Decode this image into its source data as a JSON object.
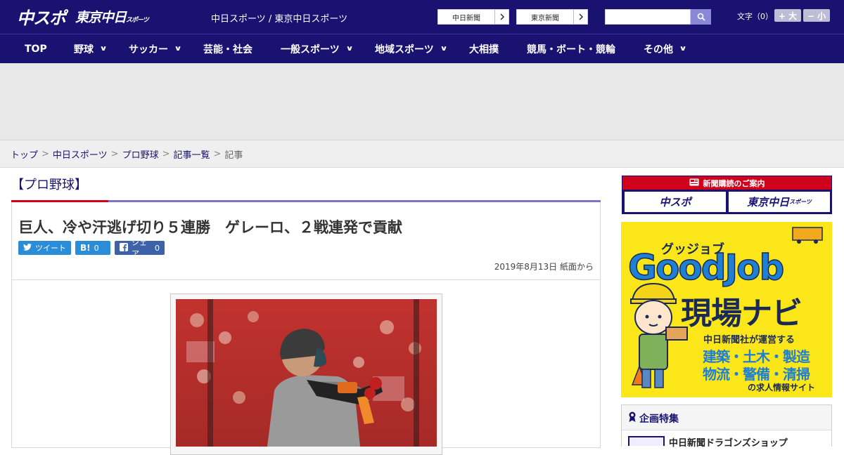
{
  "header": {
    "logo_main": "中スポ",
    "logo_sub": "東京中日",
    "logo_sub_small": "スポーツ",
    "site_title": "中日スポーツ / 東京中日スポーツ",
    "links": [
      "中日新聞",
      "東京新聞"
    ],
    "font_size_label": "文字（0）",
    "font_larger": "+ 大",
    "font_smaller": "− 小"
  },
  "nav": {
    "items": [
      {
        "label": "TOP",
        "dropdown": false
      },
      {
        "label": "野球",
        "dropdown": true
      },
      {
        "label": "サッカー",
        "dropdown": true
      },
      {
        "label": "芸能・社会",
        "dropdown": false
      },
      {
        "label": "一般スポーツ",
        "dropdown": true
      },
      {
        "label": "地域スポーツ",
        "dropdown": true
      },
      {
        "label": "大相撲",
        "dropdown": false
      },
      {
        "label": "競馬・ボート・競輪",
        "dropdown": false
      },
      {
        "label": "その他",
        "dropdown": true
      }
    ]
  },
  "breadcrumb": {
    "items": [
      "トップ",
      "中日スポーツ",
      "プロ野球",
      "記事一覧"
    ],
    "current": "記事"
  },
  "article": {
    "category": "【プロ野球】",
    "headline": "巨人、冷や汗逃げ切り５連勝　ゲレーロ、２戦連発で貢献",
    "share": {
      "tweet": "ツイート",
      "hatena_icon": "B!",
      "hatena_count": "0",
      "facebook": "シェア",
      "facebook_count": "0"
    },
    "dateline": "2019年8月13日 紙面から"
  },
  "sidebar": {
    "subscription_heading": "新聞購読のご案内",
    "subscription_links": [
      "中スポ",
      "東京中日"
    ],
    "subscription_link_small": "スポーツ",
    "goodjob": {
      "kana": "グッジョブ",
      "title": "GoodJob",
      "navi": "現場ナビ",
      "line1": "中日新聞社が運営する",
      "line2": "建築・土木・製造",
      "line3": "物流・警備・清掃",
      "line4": "の求人情報サイト"
    },
    "feature_heading": "企画特集",
    "feature_item": "中日新聞ドラゴンズショップ"
  },
  "colors": {
    "brand_navy": "#1a1270",
    "accent_red": "#d0021b",
    "twitter_blue": "#2b8dd8",
    "facebook_blue": "#3e62a8",
    "goodjob_yellow": "#fbe61a"
  }
}
